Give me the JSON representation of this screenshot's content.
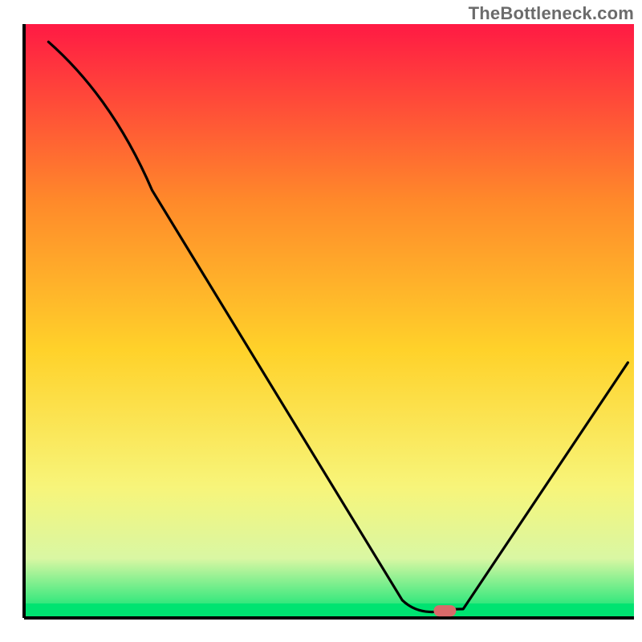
{
  "watermark": "TheBottleneck.com",
  "chart_data": {
    "type": "line",
    "title": "",
    "xlabel": "",
    "ylabel": "",
    "xlim": [
      0,
      100
    ],
    "ylim": [
      0,
      100
    ],
    "gradient_colors": {
      "top": "#ff1a44",
      "upper_mid": "#ff8a2a",
      "mid": "#ffd22a",
      "lower_mid": "#f7f57a",
      "lower": "#d9f7a3",
      "bottom": "#00e371"
    },
    "series": [
      {
        "name": "bottleneck-curve",
        "points": [
          {
            "x": 4,
            "y": 97
          },
          {
            "x": 21,
            "y": 72
          },
          {
            "x": 62,
            "y": 3
          },
          {
            "x": 67,
            "y": 1
          },
          {
            "x": 72,
            "y": 1.5
          },
          {
            "x": 99,
            "y": 43
          }
        ]
      }
    ],
    "marker": {
      "x": 69,
      "y": 1.2,
      "color": "#d96a6a"
    },
    "axes_color": "#000000"
  }
}
